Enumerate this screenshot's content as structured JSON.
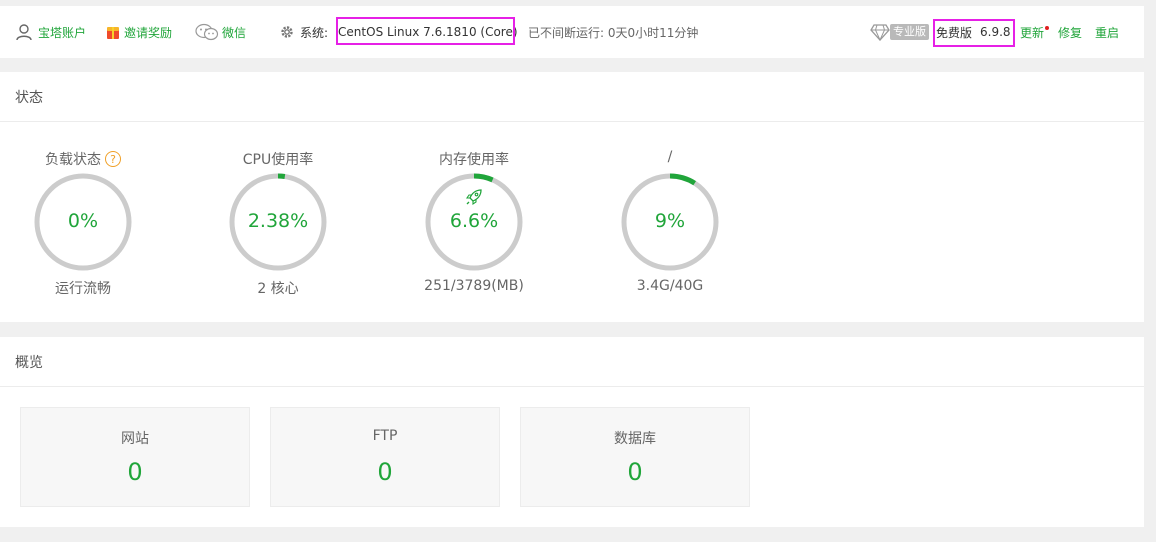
{
  "topbar": {
    "account": "宝塔账户",
    "invite": "邀请奖励",
    "wechat": "微信",
    "system_label": "系统:",
    "system_value": "CentOS Linux 7.6.1810 (Core)",
    "uptime": "已不间断运行: 0天0小时11分钟",
    "pro_badge": "专业版",
    "edition": "免费版",
    "version": "6.9.8",
    "update": "更新",
    "repair": "修复",
    "restart": "重启"
  },
  "status": {
    "title": "状态",
    "gauges": [
      {
        "title": "负载状态",
        "value": "0%",
        "sub": "运行流畅",
        "percent": 0
      },
      {
        "title": "CPU使用率",
        "value": "2.38%",
        "sub": "2 核心",
        "percent": 2.38
      },
      {
        "title": "内存使用率",
        "value": "6.6%",
        "sub": "251/3789(MB)",
        "percent": 6.6
      },
      {
        "title": "/",
        "value": "9%",
        "sub": "3.4G/40G",
        "percent": 9
      }
    ]
  },
  "overview": {
    "title": "概览",
    "cards": [
      {
        "label": "网站",
        "value": "0"
      },
      {
        "label": "FTP",
        "value": "0"
      },
      {
        "label": "数据库",
        "value": "0"
      }
    ]
  },
  "colors": {
    "accent": "#20a53a",
    "ring_track": "#cccccc",
    "highlight": "#e620e6",
    "help": "#f0a028"
  }
}
